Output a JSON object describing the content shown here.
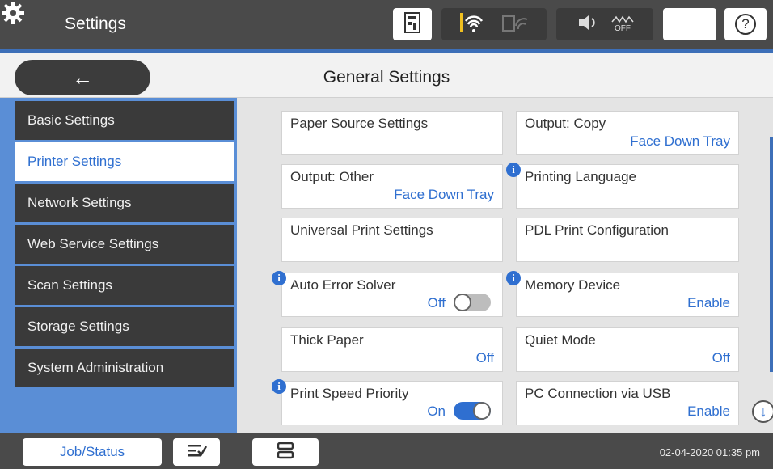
{
  "topbar": {
    "title": "Settings",
    "icons": [
      "gear-icon",
      "printer-status-icon",
      "wifi-icon",
      "wifi-direct-icon",
      "speaker-icon",
      "eco-mode-off-icon",
      "moon-icon",
      "help-icon"
    ],
    "eco_label": "OFF",
    "help_symbol": "?"
  },
  "header": {
    "back_symbol": "←",
    "title": "General Settings"
  },
  "sidebar": {
    "items": [
      {
        "label": "Basic Settings",
        "active": false
      },
      {
        "label": "Printer Settings",
        "active": true
      },
      {
        "label": "Network Settings",
        "active": false
      },
      {
        "label": "Web Service Settings",
        "active": false
      },
      {
        "label": "Scan Settings",
        "active": false
      },
      {
        "label": "Storage Settings",
        "active": false
      },
      {
        "label": "System Administration",
        "active": false
      }
    ]
  },
  "settings": [
    {
      "label": "Paper Source Settings",
      "value": "",
      "info": false
    },
    {
      "label": "Output: Copy",
      "value": "Face Down Tray",
      "info": false
    },
    {
      "label": "Output: Other",
      "value": "Face Down Tray",
      "info": false
    },
    {
      "label": "Printing Language",
      "value": "",
      "info": true
    },
    {
      "label": "Universal Print Settings",
      "value": "",
      "info": false
    },
    {
      "label": "PDL Print Configuration",
      "value": "",
      "info": false
    },
    {
      "label": "Auto Error Solver",
      "value": "Off",
      "info": true,
      "toggle": "off"
    },
    {
      "label": "Memory Device",
      "value": "Enable",
      "info": true
    },
    {
      "label": "Thick Paper",
      "value": "Off",
      "info": false
    },
    {
      "label": "Quiet Mode",
      "value": "Off",
      "info": false
    },
    {
      "label": "Print Speed Priority",
      "value": "On",
      "info": true,
      "toggle": "on"
    },
    {
      "label": "PC Connection via USB",
      "value": "Enable",
      "info": false
    }
  ],
  "info_symbol": "i",
  "scroll_down_symbol": "↓",
  "bottombar": {
    "job_status_label": "Job/Status",
    "datetime": "02-04-2020 01:35 pm"
  },
  "colors": {
    "accent": "#2f6fd0",
    "sidebar_bg": "#5a8ed6",
    "dark": "#3a3a3a"
  }
}
